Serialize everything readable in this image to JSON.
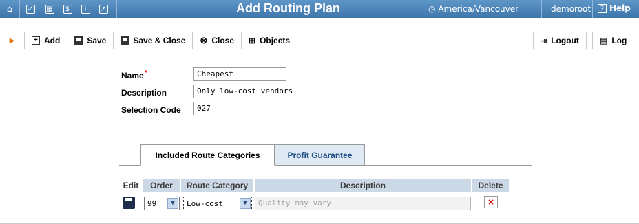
{
  "window": {
    "title": "Add Routing Plan",
    "timezone": "America/Vancouver",
    "user": "demoroot",
    "help_label": "Help"
  },
  "title_icons": [
    "home-icon",
    "checkbox-icon",
    "grid-icon",
    "dollar-icon",
    "info-icon",
    "chart-icon"
  ],
  "toolbar": {
    "add_label": "Add",
    "save_label": "Save",
    "save_close_label": "Save & Close",
    "close_label": "Close",
    "objects_label": "Objects",
    "logout_label": "Logout",
    "log_label": "Log"
  },
  "form": {
    "name_label": "Name",
    "required_mark": "*",
    "name_value": "Cheapest",
    "description_label": "Description",
    "description_value": "Only low-cost vendors",
    "selection_code_label": "Selection Code",
    "selection_code_value": "027"
  },
  "tabs": [
    {
      "label": "Included Route Categories",
      "active": true
    },
    {
      "label": "Profit Guarantee",
      "active": false
    }
  ],
  "grid": {
    "columns": [
      "Edit",
      "Order",
      "Route Category",
      "Description",
      "Delete"
    ],
    "rows": [
      {
        "order": "99",
        "route_category": "Low-cost",
        "description_placeholder": "Quality may vary",
        "delete_mark": "×"
      }
    ]
  },
  "colors": {
    "title_bar": "#4a82b8",
    "header_cell": "#cbd9e6",
    "tab_inactive_text": "#1f4f86",
    "required": "#e00000"
  }
}
